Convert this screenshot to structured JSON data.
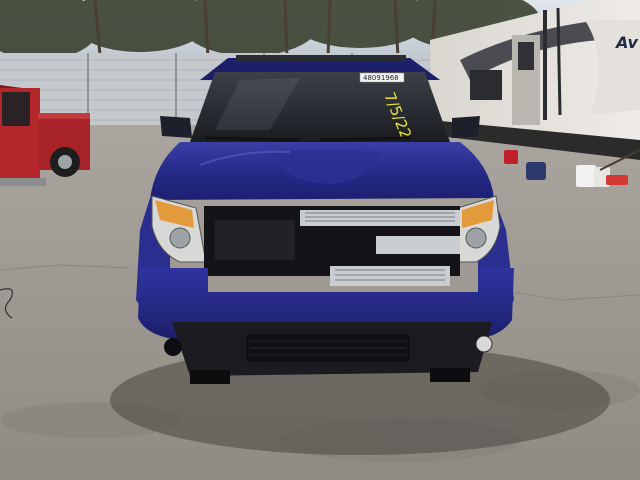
{
  "photo": {
    "subject": "Vehicle auction photo",
    "lot_tag": "48091968",
    "windshield_marker": "7/5/22",
    "rv_brand_text": "Av",
    "colors": {
      "suv_body": "#2b2f8c",
      "suv_body_dark": "#1a1c5c",
      "pickup_red": "#b3262a",
      "pavement": "#a09c95",
      "sky": "#cfd8e0",
      "fence": "#c8ccd0"
    }
  }
}
